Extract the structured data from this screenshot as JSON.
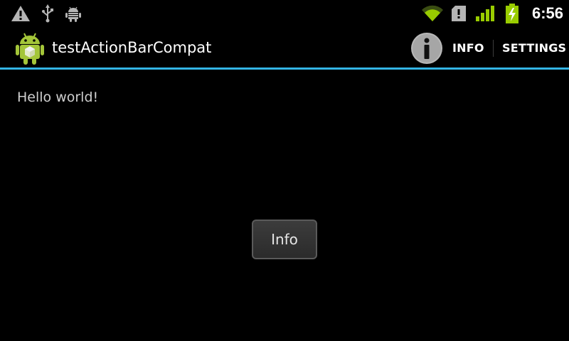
{
  "status_bar": {
    "time": "6:56",
    "icons": [
      "warning-icon",
      "usb-icon",
      "android-debug-icon",
      "wifi-icon",
      "sim-alert-icon",
      "signal-icon",
      "battery-charging-icon"
    ],
    "accent": "#99cc00"
  },
  "action_bar": {
    "title": "testActionBarCompat",
    "app_icon": "android-app-icon",
    "info_action_icon": "info-icon",
    "info_label": "INFO",
    "settings_label": "SETTINGS",
    "underline_color": "#33b5e5"
  },
  "content": {
    "hello_text": "Hello world!",
    "info_button_label": "Info"
  }
}
